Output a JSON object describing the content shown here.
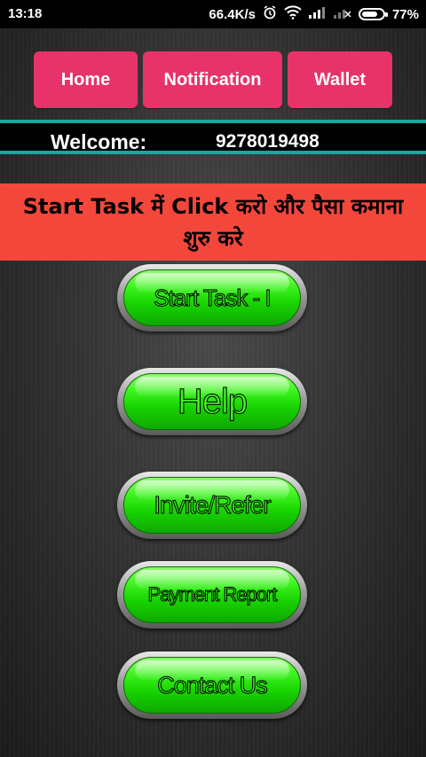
{
  "status_bar": {
    "time": "13:18",
    "speed": "66.4K/s",
    "battery": "77%",
    "battery_level": 0.77,
    "icons": [
      "alarm-icon",
      "wifi-icon",
      "signal-icon",
      "signal-off-icon",
      "battery-icon"
    ]
  },
  "nav": {
    "home": "Home",
    "notification": "Notification",
    "wallet": "Wallet"
  },
  "welcome": {
    "label": "Welcome:",
    "phone": "9278019498"
  },
  "banner": {
    "text": "Start Task में Click करो और पैसा कमाना शुरु करे"
  },
  "menu": {
    "start_task": "Start Task - I",
    "help": "Help",
    "invite": "Invite/Refer",
    "payment": "Payment Report",
    "contact": "Contact Us"
  },
  "colors": {
    "nav_button": "#e8326a",
    "welcome_border": "#18a89c",
    "banner": "#f4473c",
    "button_green": "#18d400"
  }
}
